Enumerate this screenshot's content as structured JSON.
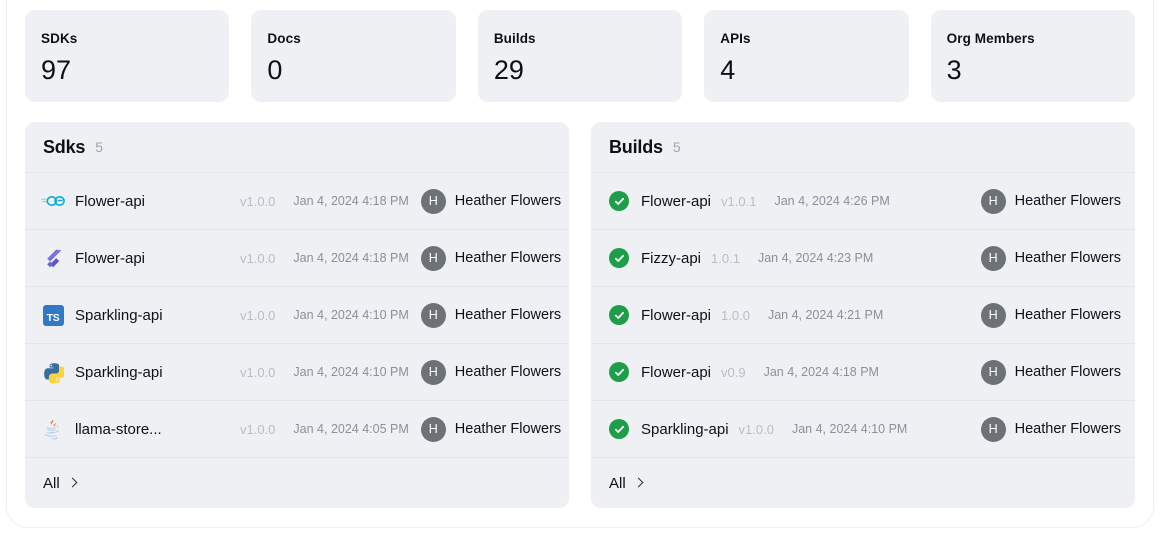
{
  "stats": [
    {
      "label": "SDKs",
      "value": "97"
    },
    {
      "label": "Docs",
      "value": "0"
    },
    {
      "label": "Builds",
      "value": "29"
    },
    {
      "label": "APIs",
      "value": "4"
    },
    {
      "label": "Org Members",
      "value": "3"
    }
  ],
  "sdks_panel": {
    "title": "Sdks",
    "count": "5",
    "footer_label": "All",
    "footer_icon": "chevron-right-icon",
    "rows": [
      {
        "icon": "go-icon",
        "name": "Flower-api",
        "version": "v1.0.0",
        "date": "Jan 4, 2024 4:18 PM",
        "avatar": "H",
        "user": "Heather Flowers"
      },
      {
        "icon": "flutter-icon",
        "name": "Flower-api",
        "version": "v1.0.0",
        "date": "Jan 4, 2024 4:18 PM",
        "avatar": "H",
        "user": "Heather Flowers"
      },
      {
        "icon": "typescript-icon",
        "name": "Sparkling-api",
        "version": "v1.0.0",
        "date": "Jan 4, 2024 4:10 PM",
        "avatar": "H",
        "user": "Heather Flowers"
      },
      {
        "icon": "python-icon",
        "name": "Sparkling-api",
        "version": "v1.0.0",
        "date": "Jan 4, 2024 4:10 PM",
        "avatar": "H",
        "user": "Heather Flowers"
      },
      {
        "icon": "java-icon",
        "name": "llama-store...",
        "version": "v1.0.0",
        "date": "Jan 4, 2024 4:05 PM",
        "avatar": "H",
        "user": "Heather Flowers"
      }
    ]
  },
  "builds_panel": {
    "title": "Builds",
    "count": "5",
    "footer_label": "All",
    "footer_icon": "chevron-right-icon",
    "rows": [
      {
        "icon": "check-circle-icon",
        "name": "Flower-api",
        "version": "v1.0.1",
        "date": "Jan 4, 2024 4:26 PM",
        "avatar": "H",
        "user": "Heather Flowers"
      },
      {
        "icon": "check-circle-icon",
        "name": "Fizzy-api",
        "version": "1.0.1",
        "date": "Jan 4, 2024 4:23 PM",
        "avatar": "H",
        "user": "Heather Flowers"
      },
      {
        "icon": "check-circle-icon",
        "name": "Flower-api",
        "version": "1.0.0",
        "date": "Jan 4, 2024 4:21 PM",
        "avatar": "H",
        "user": "Heather Flowers"
      },
      {
        "icon": "check-circle-icon",
        "name": "Flower-api",
        "version": "v0.9",
        "date": "Jan 4, 2024 4:18 PM",
        "avatar": "H",
        "user": "Heather Flowers"
      },
      {
        "icon": "check-circle-icon",
        "name": "Sparkling-api",
        "version": "v1.0.0",
        "date": "Jan 4, 2024 4:10 PM",
        "avatar": "H",
        "user": "Heather Flowers"
      }
    ]
  },
  "colors": {
    "page_background": "#ffffff",
    "card_background": "#eff0f3",
    "divider": "#e3e5ea",
    "text_primary": "#0d1117",
    "text_muted": "#8a9099",
    "text_faint": "#b9bdc5",
    "avatar_background": "#6d7178",
    "status_success": "#1e9e4a",
    "go_accent": "#00add8",
    "typescript_accent": "#3178c6",
    "python_blue": "#366f9f",
    "python_yellow": "#ffd43b",
    "flutter_purple": "#6b62d6"
  }
}
